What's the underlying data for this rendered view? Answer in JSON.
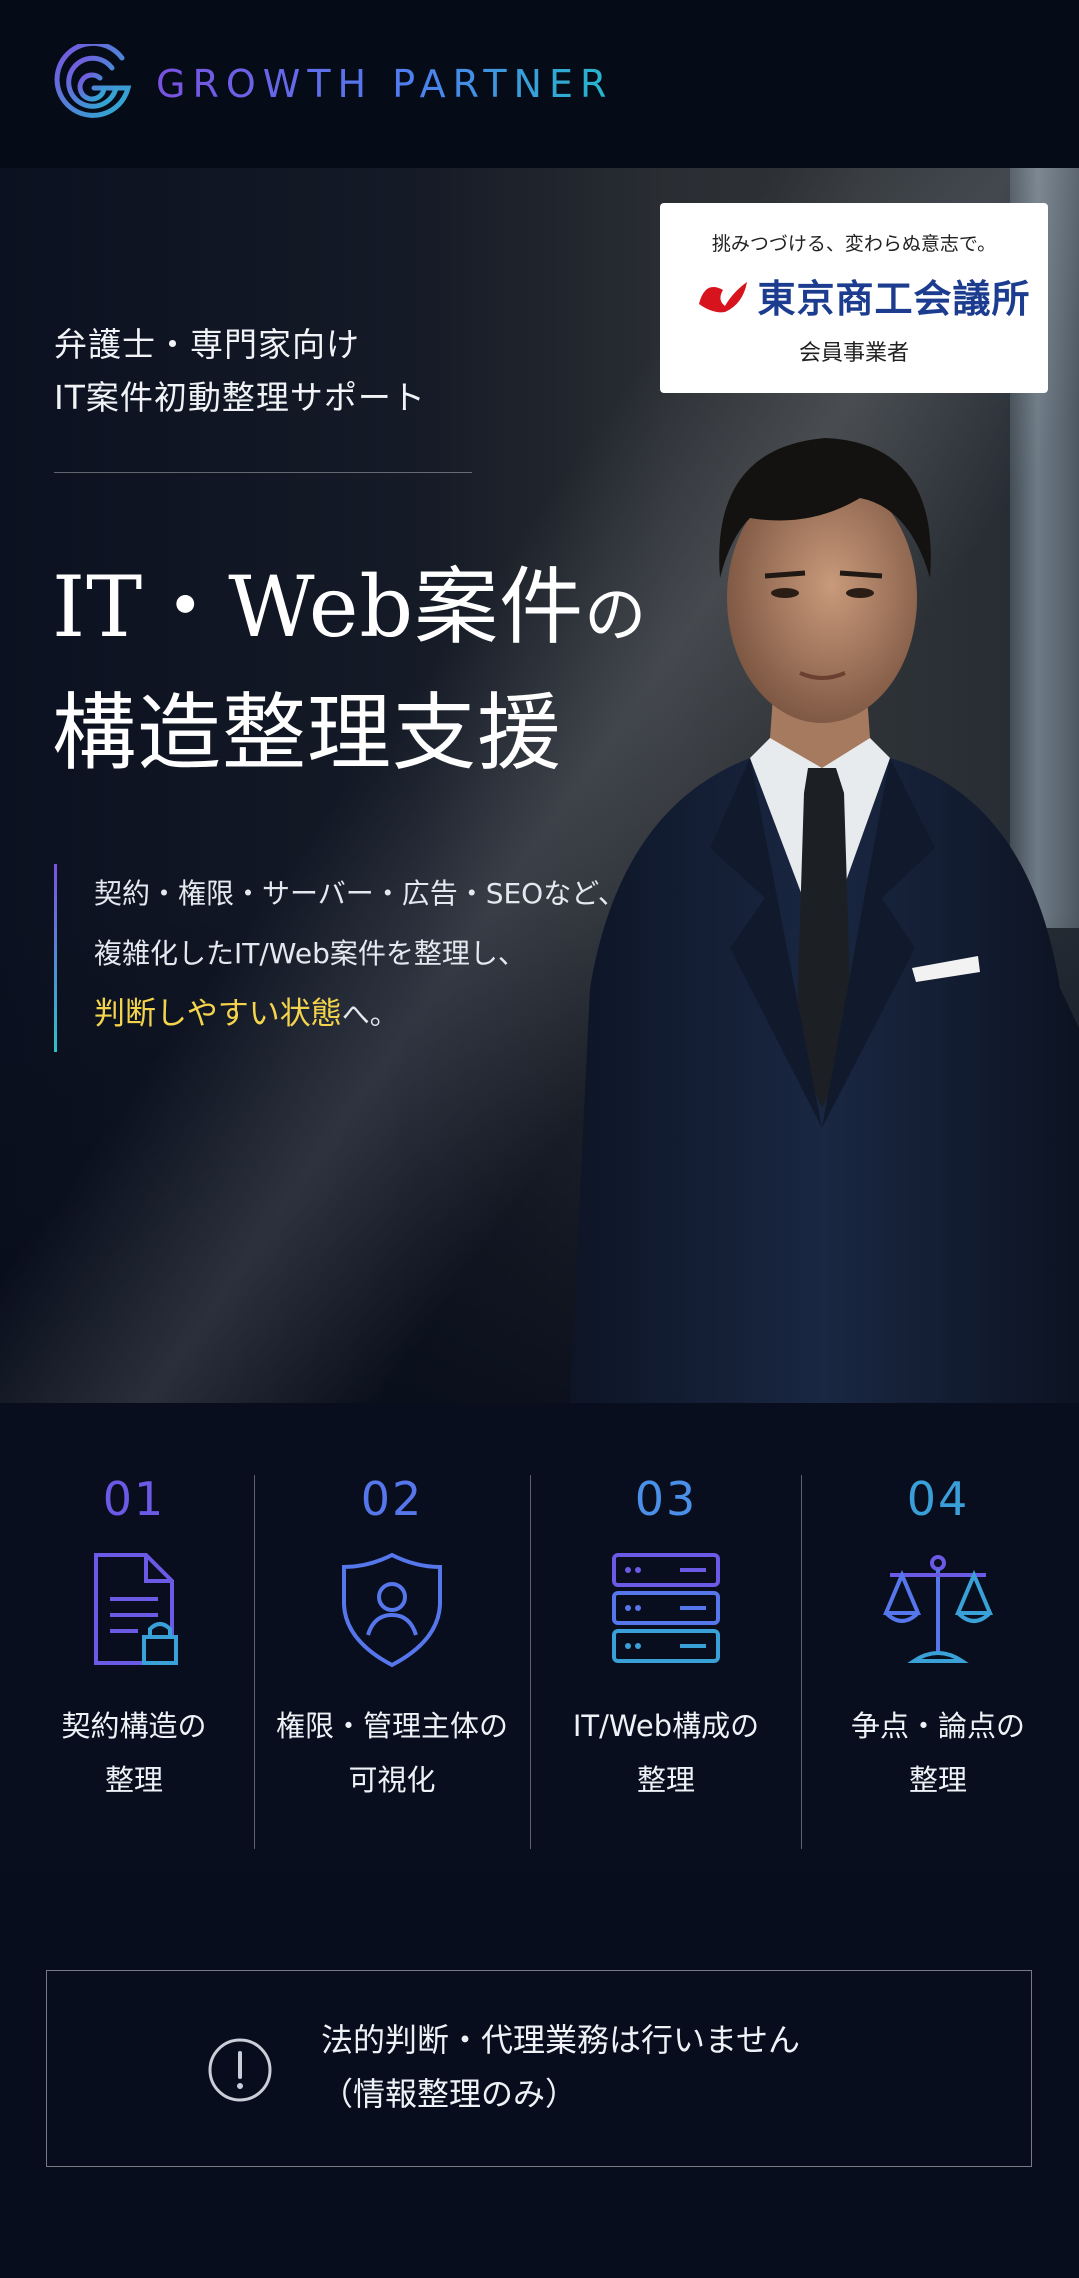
{
  "header": {
    "brand": "GROWTH PARTNER",
    "logo_icon": "growth-partner-g-logo"
  },
  "badge": {
    "tagline": "挑みつづける、変わらぬ意志で。",
    "organization": "東京商工会議所",
    "member_label": "会員事業者",
    "logo_icon": "tcci-logo"
  },
  "hero": {
    "eyebrow_line1": "弁護士・専門家向け",
    "eyebrow_line2": "IT案件初動整理サポート",
    "headline_line1a": "IT・Web案件",
    "headline_line1b": "の",
    "headline_line2": "構造整理支援",
    "lead_line1": "契約・権限・サーバー・広告・SEOなど、",
    "lead_line2": "複雑化したIT/Web案件を整理し、",
    "lead_highlight": "判断しやすい状態",
    "lead_tail": "へ。",
    "image": "businessman-portrait",
    "highlight_color": "#f4d44d"
  },
  "features": [
    {
      "num": "01",
      "label": "契約構造の\n整理",
      "icon": "document-lock-icon",
      "color": "#6b5ae6"
    },
    {
      "num": "02",
      "label": "権限・管理主体の\n可視化",
      "icon": "shield-user-icon",
      "color": "#5676ec"
    },
    {
      "num": "03",
      "label": "IT/Web構成の\n整理",
      "icon": "server-stack-icon",
      "color": "#4a8fe8"
    },
    {
      "num": "04",
      "label": "争点・論点の\n整理",
      "icon": "scales-icon",
      "color": "#3a9fd8"
    }
  ],
  "notice": {
    "line1": "法的判断・代理業務は行いません",
    "line2": "（情報整理のみ）",
    "icon": "exclamation-circle-icon"
  }
}
